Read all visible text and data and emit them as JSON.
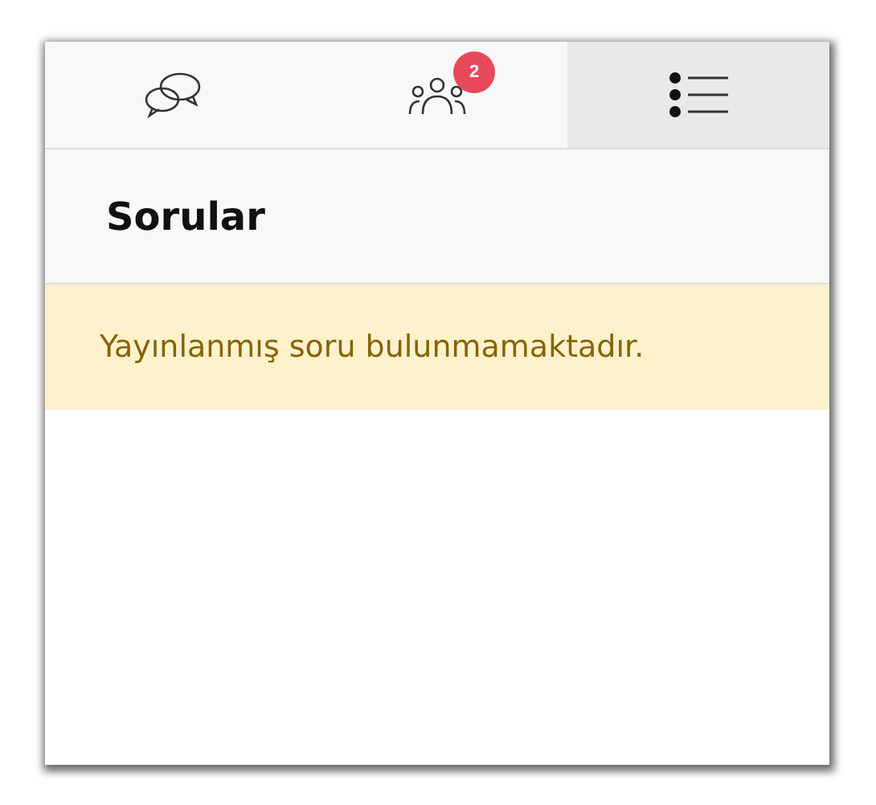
{
  "tabs": [
    {
      "kind": "chat",
      "selected": false
    },
    {
      "kind": "people",
      "selected": false,
      "badge": "2"
    },
    {
      "kind": "list",
      "selected": true
    }
  ],
  "panel": {
    "title": "Sorular",
    "alert": "Yayınlanmış soru bulunmamaktadır."
  }
}
